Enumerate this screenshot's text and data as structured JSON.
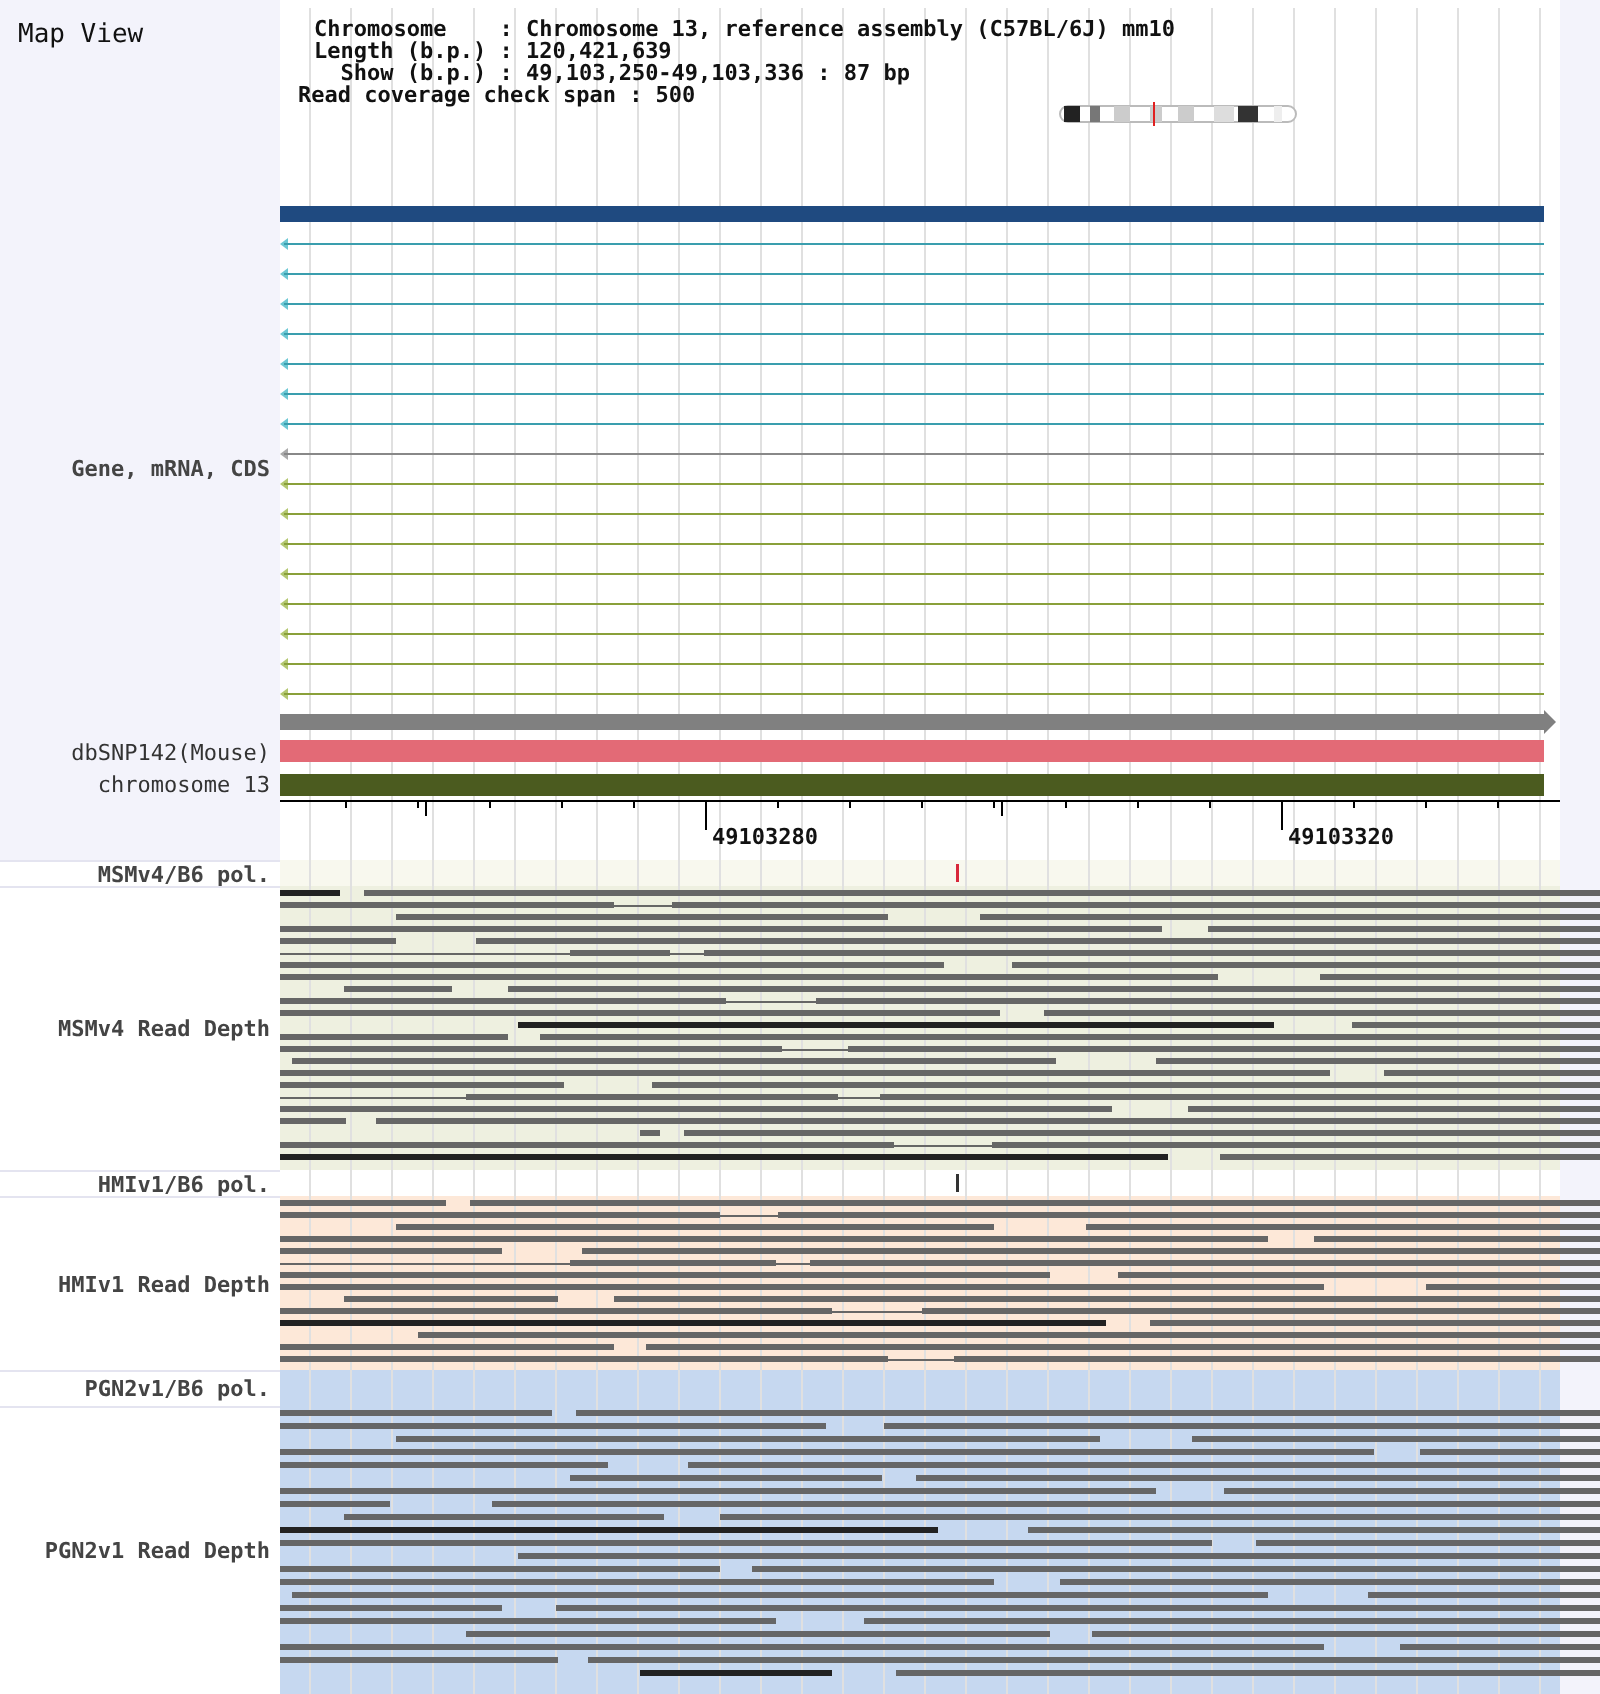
{
  "header": {
    "title": "Map View",
    "info_lines": [
      "Chromosome    : Chromosome 13, reference assembly (C57BL/6J) mm10",
      "Length (b.p.) : 120,421,639",
      "  Show (b.p.) : 49,103,250-49,103,336 : 87 bp",
      "Read coverage check span : 500"
    ]
  },
  "gene_track": {
    "label": "Gene, mRNA, CDS"
  },
  "feature_tracks": [
    {
      "label": "dbSNP142(Mouse)",
      "color": "#e36a76"
    },
    {
      "label": "chromosome 13",
      "color": "#4b5b1f"
    }
  ],
  "ruler": {
    "labels": [
      "49103280",
      "49103320"
    ]
  },
  "sample_tracks": [
    {
      "kind": "pol",
      "label": "MSMv4/B6 pol.",
      "color": "#f8f8ee",
      "variant": {
        "color": "#d8283a"
      }
    },
    {
      "kind": "depth",
      "label": "MSMv4 Read Depth",
      "color": "#eef0e0"
    },
    {
      "kind": "pol",
      "label": "HMIv1/B6 pol.",
      "color": "#ffffff",
      "variant": {
        "color": "#333333"
      }
    },
    {
      "kind": "depth",
      "label": "HMIv1 Read Depth",
      "color": "#fde8d8"
    },
    {
      "kind": "pol",
      "label": "PGN2v1/B6 pol.",
      "color": "#c6d8f0"
    },
    {
      "kind": "depth",
      "label": "PGN2v1 Read Depth",
      "color": "#c6d8f0"
    }
  ]
}
